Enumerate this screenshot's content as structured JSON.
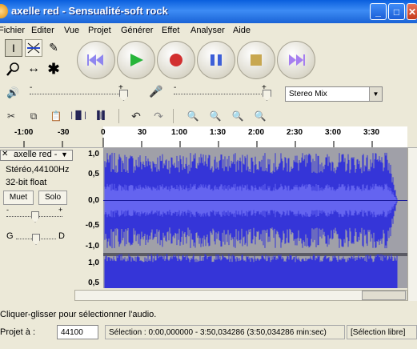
{
  "window": {
    "title": "axelle red  -  Sensualité-soft rock",
    "buttons": [
      "minimize-icon",
      "maximize-icon",
      "close-icon"
    ]
  },
  "menu": [
    "Fichier",
    "Editer",
    "Vue",
    "Projet",
    "Générer",
    "Effet",
    "Analyser",
    "Aide"
  ],
  "tools": [
    "selection-icon",
    "envelope-icon",
    "draw-icon",
    "zoom-icon",
    "timeshift-icon",
    "multi-tool-icon"
  ],
  "transport": [
    "rewind-icon",
    "play-icon",
    "record-icon",
    "pause-icon",
    "stop-icon",
    "fast-forward-icon"
  ],
  "mixer": {
    "volume_minus": "-",
    "volume_plus": "+",
    "input_minus": "-",
    "input_plus": "+",
    "input_source": "Stereo Mix"
  },
  "ruler_ticks": [
    "-1:00",
    "-30",
    "0",
    "30",
    "1:00",
    "1:30",
    "2:00",
    "2:30",
    "3:00",
    "3:30"
  ],
  "track": {
    "name": "axelle red -",
    "format": "Stéréo,44100Hz",
    "bits": "32-bit float",
    "mute": "Muet",
    "solo": "Solo",
    "gain_minus": "-",
    "gain_plus": "+",
    "pan_left": "G",
    "pan_right": "D",
    "close": "✕",
    "menu_arrow": "▼"
  },
  "amplitude_labels_top": [
    "1,0",
    "0,5",
    "0,0",
    "-0,5",
    "-1,0"
  ],
  "amplitude_labels_bottom": [
    "1,0",
    "0,5"
  ],
  "status": "Cliquer-glisser pour sélectionner l'audio.",
  "bottom": {
    "rate_label": "Projet à :",
    "rate_value": "44100",
    "selection": "Sélection : 0:00,000000 - 3:50,034286 (3:50,034286 min:sec)",
    "snap": "[Sélection libre]"
  },
  "colors": {
    "waveform": "#3535d8",
    "waveform_rms": "#6464f0",
    "wave_background": "#a0a0a8",
    "titlebar": "#0a5fdd"
  }
}
